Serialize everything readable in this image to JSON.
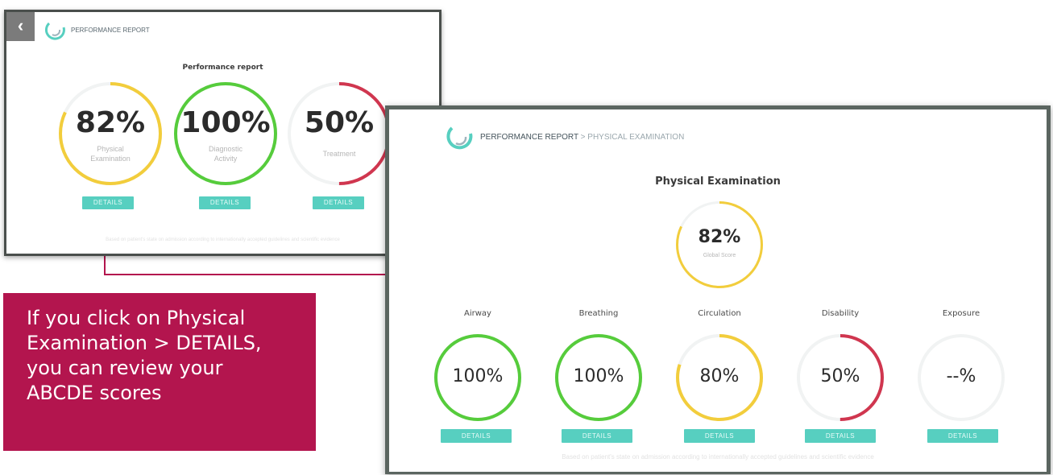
{
  "colors": {
    "accent_teal": "#57cfc0",
    "ring_yellow": "#f2cd3c",
    "ring_green": "#56cc3c",
    "ring_red": "#d0364f",
    "callout_bg": "#b3154e",
    "connector": "#b3154e"
  },
  "icons": {
    "back": "chevron-left-icon",
    "logo": "app-swirl-logo-icon"
  },
  "overview": {
    "header": "PERFORMANCE REPORT",
    "title": "Performance report",
    "scores": [
      {
        "value": "82%",
        "label_line1": "Physical",
        "label_line2": "Examination",
        "progress": 0.82,
        "color": "#f2cd3c",
        "button": "DETAILS"
      },
      {
        "value": "100%",
        "label_line1": "Diagnostic",
        "label_line2": "Activity",
        "progress": 1.0,
        "color": "#56cc3c",
        "button": "DETAILS"
      },
      {
        "value": "50%",
        "label_line1": "Treatment",
        "label_line2": "",
        "progress": 0.5,
        "color": "#d0364f",
        "button": "DETAILS"
      }
    ],
    "footnote": "Based on patient's state on admission according to internationally accepted guidelines and scientific evidence"
  },
  "detail": {
    "header_main": "PERFORMANCE REPORT",
    "header_sub": " > PHYSICAL EXAMINATION",
    "title": "Physical Examination",
    "global": {
      "value": "82%",
      "label": "Global Score",
      "progress": 0.82,
      "color": "#f2cd3c"
    },
    "categories": [
      {
        "name": "Airway",
        "value": "100%",
        "progress": 1.0,
        "color": "#56cc3c",
        "button": "DETAILS"
      },
      {
        "name": "Breathing",
        "value": "100%",
        "progress": 1.0,
        "color": "#56cc3c",
        "button": "DETAILS"
      },
      {
        "name": "Circulation",
        "value": "80%",
        "progress": 0.8,
        "color": "#f2cd3c",
        "button": "DETAILS"
      },
      {
        "name": "Disability",
        "value": "50%",
        "progress": 0.5,
        "color": "#d0364f",
        "button": "DETAILS"
      },
      {
        "name": "Exposure",
        "value": "--%",
        "progress": 0,
        "color": "#d0364f",
        "button": "DETAILS"
      }
    ],
    "footnote": "Based on patient's state on admission according to internationally accepted guidelines and scientific evidence"
  },
  "callout": {
    "lines": [
      "If you click on Physical",
      "Examination > DETAILS,",
      "you can review your",
      "ABCDE scores"
    ]
  }
}
